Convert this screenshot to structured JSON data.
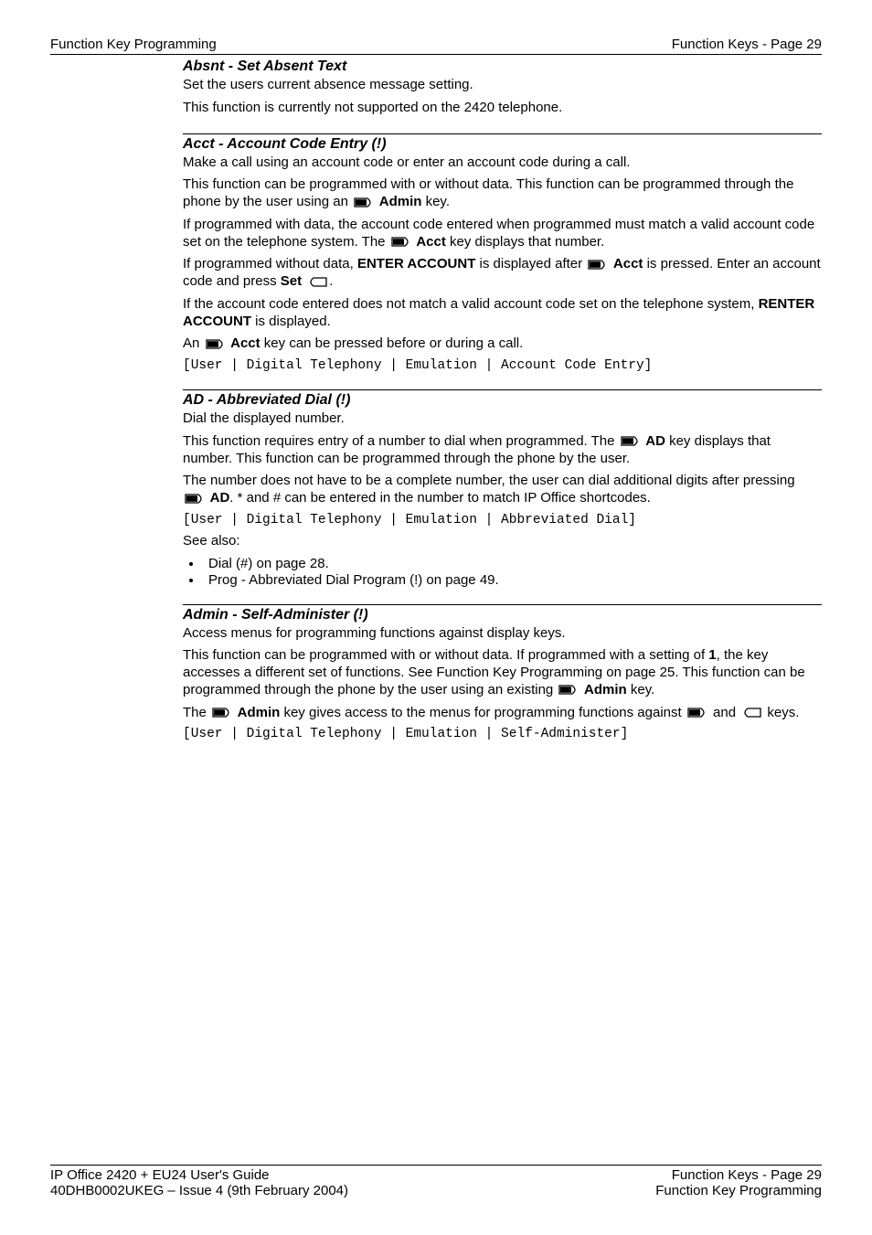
{
  "header": {
    "left": "Function Key Programming",
    "right": "Function Keys - Page 29"
  },
  "sections": {
    "absnt": {
      "title": "Absnt - Set Absent Text",
      "p1": "Set the users current absence message setting.",
      "p2": "This function is currently not supported on the 2420 telephone."
    },
    "acct": {
      "title": "Acct - Account Code Entry (!)",
      "p1": "Make a call using an account code or enter an account code during a call.",
      "p2a": "This function can be programmed with or without data. This function can be programmed through the phone by the user using an ",
      "p2b": " Admin",
      "p2c": " key.",
      "p3a": "If programmed with data, the account code entered when programmed must match a valid account code set on the telephone system. The ",
      "p3b": " Acct",
      "p3c": " key displays that number.",
      "p4a": "If programmed without data, ",
      "p4b": "ENTER ACCOUNT",
      "p4c": " is displayed after ",
      "p4d": " Acct",
      "p4e": " is pressed. Enter an account code and press ",
      "p4f": "Set ",
      "p4g": ".",
      "p5a": "If the account code entered does not match a valid account code set on the telephone system, ",
      "p5b": "RENTER ACCOUNT",
      "p5c": " is displayed.",
      "p6a": "An ",
      "p6b": " Acct",
      "p6c": " key can be pressed before or during a call.",
      "code": "[User | Digital Telephony | Emulation | Account Code Entry]"
    },
    "ad": {
      "title": "AD - Abbreviated Dial (!)",
      "p1": "Dial the displayed number.",
      "p2a": "This function requires entry of a number to dial when programmed. The ",
      "p2b": " AD",
      "p2c": " key displays that number. This function can be programmed through the phone by the user.",
      "p3a": "The number does not have to be a complete number, the user can dial additional digits after pressing ",
      "p3b": " AD",
      "p3c": ". * and # can be entered in the number to match IP Office shortcodes.",
      "code": "[User | Digital Telephony | Emulation | Abbreviated Dial]",
      "seealso": "See also:",
      "bullet1": "Dial (#) on page 28.",
      "bullet2": "Prog - Abbreviated Dial Program (!) on page 49."
    },
    "admin": {
      "title": "Admin - Self-Administer (!)",
      "p1": "Access menus for programming functions against display keys.",
      "p2a": "This function can be programmed with or without data. If programmed with a setting of ",
      "p2b": "1",
      "p2c": ", the key accesses a different set of functions. See Function Key Programming on page 25. This function can be programmed through the phone by the user using an existing ",
      "p2d": " Admin",
      "p2e": " key.",
      "p3a": "The ",
      "p3b": " Admin",
      "p3c": " key gives access to the menus for programming functions against ",
      "p3d": " and ",
      "p3e": " keys.",
      "code": "[User | Digital Telephony | Emulation | Self-Administer]"
    }
  },
  "footer": {
    "left1": "IP Office 2420 + EU24 User's Guide",
    "left2": "40DHB0002UKEG – Issue 4 (9th February 2004)",
    "right1": "Function Keys - Page 29",
    "right2": "Function Key Programming"
  }
}
